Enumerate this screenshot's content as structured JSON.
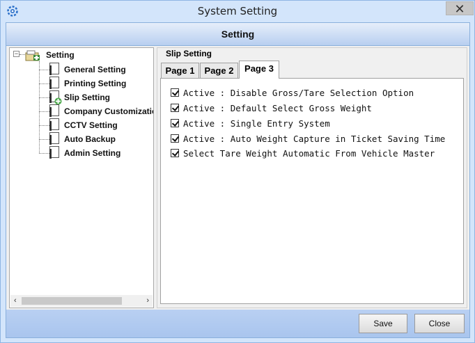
{
  "window": {
    "title": "System Setting",
    "close_glyph": "✕",
    "icon": "gear-icon"
  },
  "header": {
    "title": "Setting"
  },
  "tree": {
    "root": {
      "label": "Setting",
      "expander": "−"
    },
    "items": [
      {
        "label": "General Setting"
      },
      {
        "label": "Printing Setting"
      },
      {
        "label": "Slip Setting",
        "selected": true
      },
      {
        "label": "Company Customization"
      },
      {
        "label": "CCTV Setting"
      },
      {
        "label": "Auto Backup"
      },
      {
        "label": "Admin Setting"
      }
    ],
    "scroll_left": "‹",
    "scroll_right": "›"
  },
  "group": {
    "title": "Slip Setting",
    "tabs": [
      {
        "label": "Page 1"
      },
      {
        "label": "Page 2"
      },
      {
        "label": "Page 3",
        "active": true
      }
    ],
    "options": [
      {
        "label": "Active : Disable Gross/Tare Selection Option",
        "checked": true
      },
      {
        "label": "Active : Default Select Gross Weight",
        "checked": true
      },
      {
        "label": "Active : Single Entry System",
        "checked": true
      },
      {
        "label": "Active : Auto Weight Capture in Ticket Saving Time",
        "checked": true
      },
      {
        "label": "Select Tare Weight Automatic From Vehicle Master",
        "checked": true
      }
    ]
  },
  "footer": {
    "save_label": "Save",
    "close_label": "Close"
  }
}
